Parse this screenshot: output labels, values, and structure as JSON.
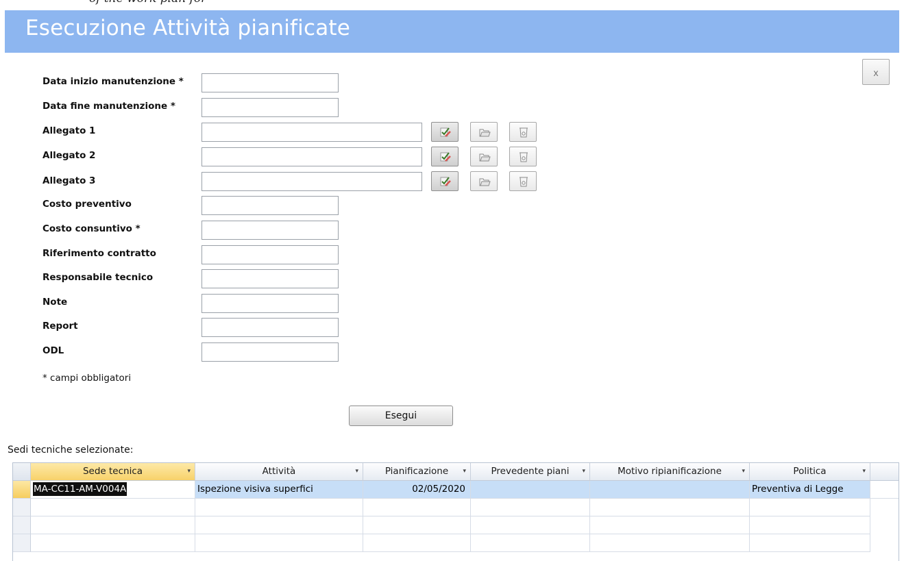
{
  "top_caption": "of the work plan for",
  "window": {
    "title": "Esecuzione Attività pianificate",
    "close_label": "x"
  },
  "form": {
    "fields": [
      {
        "label": "Data inizio manutenzione *",
        "value": ""
      },
      {
        "label": "Data fine manutenzione *",
        "value": ""
      },
      {
        "label": "Allegato 1",
        "value": ""
      },
      {
        "label": "Allegato 2",
        "value": ""
      },
      {
        "label": "Allegato 3",
        "value": ""
      },
      {
        "label": "Costo preventivo",
        "value": ""
      },
      {
        "label": "Costo consuntivo *",
        "value": ""
      },
      {
        "label": "Riferimento contratto",
        "value": ""
      },
      {
        "label": "Responsabile tecnico",
        "value": ""
      },
      {
        "label": "Note",
        "value": ""
      },
      {
        "label": "Report",
        "value": ""
      },
      {
        "label": "ODL",
        "value": ""
      }
    ],
    "attachment_icons": [
      "check-edit-icon",
      "open-folder-icon",
      "trash-icon"
    ],
    "required_note": "* campi obbligatori",
    "run_button": "Esegui"
  },
  "grid": {
    "label": "Sedi tecniche selezionate:",
    "dropdown_arrow": "▾",
    "columns": [
      "Sede tecnica",
      "Attività",
      "Pianificazione",
      "Prevedente piani",
      "Motivo ripianificazione",
      "Politica"
    ],
    "rows": [
      [
        "MA-CC11-AM-V004A",
        "Ispezione visiva superfici",
        "02/05/2020",
        "",
        "",
        "Preventiva di Legge"
      ]
    ]
  },
  "colors": {
    "title_bar": "#8db6f0",
    "selected_row": "#c7def7",
    "active_header": "#f8d26a"
  }
}
